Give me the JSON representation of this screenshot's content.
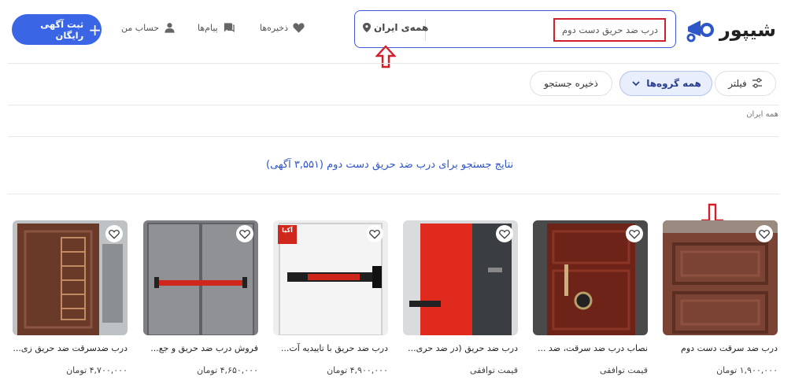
{
  "logo": {
    "name": "شیپور"
  },
  "search": {
    "value": "درب ضد حریق دست دوم",
    "location": "همه‌ی ایران"
  },
  "header_nav": [
    {
      "label": "ذخیره‌ها",
      "icon": "heart-icon"
    },
    {
      "label": "پیام‌ها",
      "icon": "chat-icon"
    },
    {
      "label": "حساب من",
      "icon": "user-icon"
    }
  ],
  "post_button": {
    "label": "ثبت آگهی رایگان",
    "icon": "plus-icon"
  },
  "filters": {
    "filter_label": "فیلتر",
    "category_label": "همه گروه‌ها",
    "save_search_label": "ذخیره جستجو"
  },
  "breadcrumb": "همه ایران",
  "results_text": "نتایج جستجو برای درب ضد حریق دست دوم  (۳,۵۵۱ آگهی)",
  "listings": [
    {
      "title": "درب ضد سرقت دست دوم",
      "price": "۱,۹۰۰,۰۰۰ تومان"
    },
    {
      "title": "نصاب درب ضد سرقت، ضد ...",
      "price": "قیمت  توافقی"
    },
    {
      "title": "درب ضد حریق (در ضد حری...",
      "price": "قیمت  توافقی"
    },
    {
      "title": "درب ضد حریق با تاییدیه آت...",
      "price": "۴,۹۰۰,۰۰۰ تومان",
      "sticker": "آکیا"
    },
    {
      "title": "فروش درب ضد حریق و جع...",
      "price": "۴,۶۵۰,۰۰۰ تومان"
    },
    {
      "title": "درب ضدسرقت ضد حریق زی...",
      "price": "۴,۷۰۰,۰۰۰ تومان"
    }
  ],
  "colors": {
    "accent": "#3a66e6",
    "highlight_red": "#d21f2c",
    "results_blue": "#2f56c8"
  }
}
